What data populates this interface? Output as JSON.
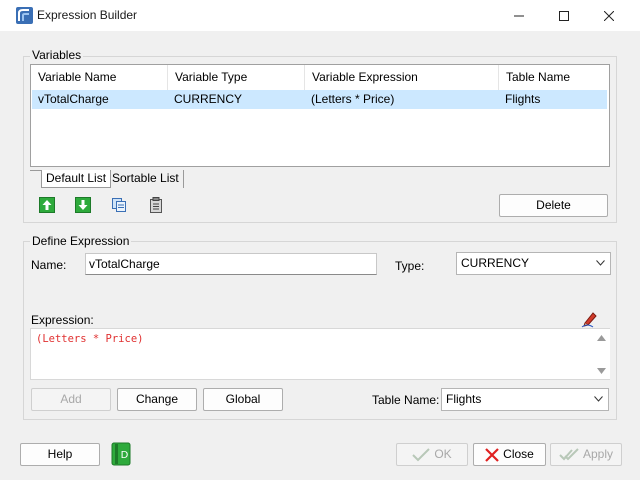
{
  "window": {
    "title": "Expression Builder"
  },
  "variables": {
    "group_title": "Variables",
    "columns": [
      "Variable Name",
      "Variable Type",
      "Variable Expression",
      "Table Name"
    ],
    "rows": [
      [
        "vTotalCharge",
        "CURRENCY",
        "(Letters * Price)",
        "Flights"
      ]
    ],
    "tabs": [
      "Default List",
      "Sortable List"
    ],
    "delete_label": "Delete"
  },
  "define": {
    "group_title": "Define Expression",
    "name_label": "Name:",
    "name_value": "vTotalCharge",
    "type_label": "Type:",
    "type_value": "CURRENCY",
    "expression_label": "Expression:",
    "expression_value": "(Letters * Price)",
    "add_label": "Add",
    "change_label": "Change",
    "global_label": "Global",
    "table_name_label": "Table Name:",
    "table_name_value": "Flights"
  },
  "footer": {
    "help_label": "Help",
    "ok_label": "OK",
    "close_label": "Close",
    "apply_label": "Apply"
  },
  "colors": {
    "selection": "#cce8ff",
    "expression_text": "#e03030",
    "accent_green": "#2eaa3c"
  }
}
